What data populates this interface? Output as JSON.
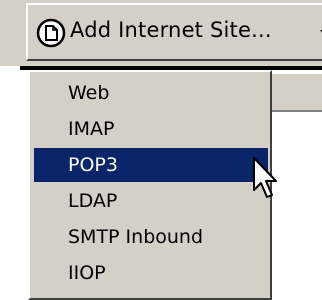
{
  "toolbar": {
    "add_button_label": "Add Internet Site...",
    "add_button_icon": "new-page-icon"
  },
  "menu": {
    "items": [
      {
        "label": "Web",
        "selected": false
      },
      {
        "label": "IMAP",
        "selected": false
      },
      {
        "label": "POP3",
        "selected": true
      },
      {
        "label": "LDAP",
        "selected": false
      },
      {
        "label": "SMTP Inbound",
        "selected": false
      },
      {
        "label": "IIOP",
        "selected": false
      }
    ]
  },
  "colors": {
    "face": "#d4d0c8",
    "highlight": "#0a246a",
    "highlight_text": "#ffffff"
  }
}
